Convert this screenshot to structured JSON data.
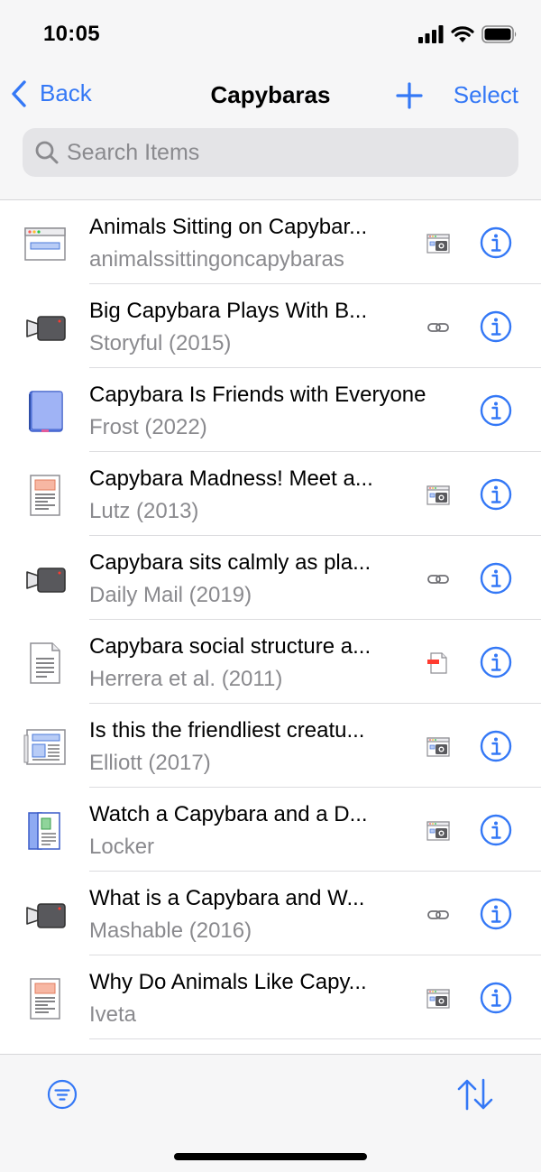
{
  "status_bar": {
    "time": "10:05"
  },
  "nav": {
    "back_label": "Back",
    "title": "Capybaras",
    "select_label": "Select"
  },
  "search": {
    "placeholder": "Search Items",
    "value": ""
  },
  "items": [
    {
      "title": "Animals Sitting on Capybar...",
      "subtitle": "animalssittingoncapybaras",
      "icon": "webpage-icon",
      "attachment": "web-snapshot-icon"
    },
    {
      "title": "Big Capybara Plays With B...",
      "subtitle": "Storyful (2015)",
      "icon": "video-icon",
      "attachment": "link-icon"
    },
    {
      "title": "Capybara Is Friends with Everyone",
      "subtitle": "Frost (2022)",
      "icon": "book-icon",
      "attachment": ""
    },
    {
      "title": "Capybara Madness! Meet a...",
      "subtitle": "Lutz (2013)",
      "icon": "magazine-article-icon",
      "attachment": "web-snapshot-icon"
    },
    {
      "title": "Capybara sits calmly as pla...",
      "subtitle": "Daily Mail (2019)",
      "icon": "video-icon",
      "attachment": "link-icon"
    },
    {
      "title": "Capybara social structure a...",
      "subtitle": "Herrera et al. (2011)",
      "icon": "journal-article-icon",
      "attachment": "pdf-icon"
    },
    {
      "title": "Is this the friendliest creatu...",
      "subtitle": "Elliott (2017)",
      "icon": "newspaper-article-icon",
      "attachment": "web-snapshot-icon"
    },
    {
      "title": "Watch a Capybara and a D...",
      "subtitle": "Locker",
      "icon": "blog-post-icon",
      "attachment": "web-snapshot-icon"
    },
    {
      "title": "What is a Capybara and W...",
      "subtitle": "Mashable (2016)",
      "icon": "video-icon",
      "attachment": "link-icon"
    },
    {
      "title": "Why Do Animals Like Capy...",
      "subtitle": "Iveta",
      "icon": "magazine-article-icon",
      "attachment": "web-snapshot-icon"
    }
  ],
  "colors": {
    "accent": "#3478f6",
    "secondary_text": "#8a8a8e",
    "bar_background": "#f6f6f7"
  }
}
